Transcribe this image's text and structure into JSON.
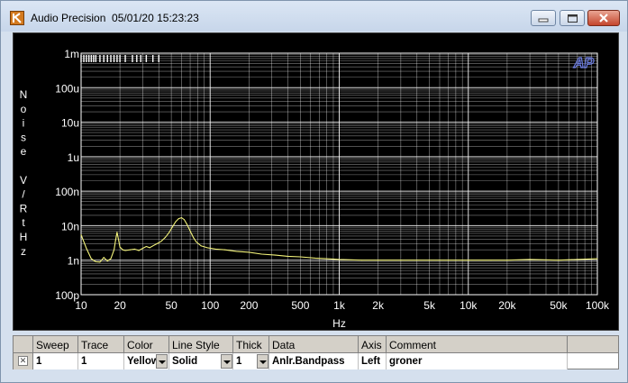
{
  "window": {
    "title": "Audio Precision  05/01/20 15:23:23",
    "app_name": "Audio Precision",
    "timestamp": "05/01/20 15:23:23"
  },
  "graph": {
    "y_axis_label_letters": [
      "N",
      "o",
      "i",
      "s",
      "e",
      " ",
      "V",
      "/",
      "R",
      "t",
      "H",
      "z"
    ],
    "x_axis_label": "Hz",
    "logo": "AP",
    "background_color": "#000000",
    "grid_color": "#ffffff",
    "trace_color": "#f2f27a"
  },
  "chart_data": {
    "type": "line",
    "xscale": "log",
    "yscale": "log",
    "xlim": [
      10,
      100000
    ],
    "ylim": [
      1e-10,
      0.001
    ],
    "xlabel": "Hz",
    "ylabel": "Noise V/RtHz",
    "grid": true,
    "x_ticks": [
      {
        "value": 10,
        "label": "10"
      },
      {
        "value": 20,
        "label": "20"
      },
      {
        "value": 50,
        "label": "50"
      },
      {
        "value": 100,
        "label": "100"
      },
      {
        "value": 200,
        "label": "200"
      },
      {
        "value": 500,
        "label": "500"
      },
      {
        "value": 1000,
        "label": "1k"
      },
      {
        "value": 2000,
        "label": "2k"
      },
      {
        "value": 5000,
        "label": "5k"
      },
      {
        "value": 10000,
        "label": "10k"
      },
      {
        "value": 20000,
        "label": "20k"
      },
      {
        "value": 50000,
        "label": "50k"
      },
      {
        "value": 100000,
        "label": "100k"
      }
    ],
    "y_ticks": [
      {
        "value": 0.001,
        "label": "1m"
      },
      {
        "value": 0.0001,
        "label": "100u"
      },
      {
        "value": 1e-05,
        "label": "10u"
      },
      {
        "value": 1e-06,
        "label": "1u"
      },
      {
        "value": 1e-07,
        "label": "100n"
      },
      {
        "value": 1e-08,
        "label": "10n"
      },
      {
        "value": 1e-09,
        "label": "1n"
      },
      {
        "value": 1e-10,
        "label": "100p"
      }
    ],
    "series": [
      {
        "x": [
          10,
          11,
          12,
          13,
          14,
          15,
          16,
          17,
          18,
          18.5,
          19,
          19.5,
          20,
          21,
          22,
          24,
          26,
          28,
          30,
          32,
          34,
          36,
          38,
          40,
          42,
          45,
          48,
          51,
          54,
          57,
          60,
          63,
          66,
          70,
          74,
          78,
          85,
          95,
          110,
          130,
          160,
          200,
          250,
          320,
          400,
          500,
          650,
          800,
          1000,
          1500,
          2000,
          3000,
          5000,
          7000,
          10000,
          15000,
          20000,
          30000,
          50000,
          70000,
          100000
        ],
        "y": [
          5.5e-09,
          2.2e-09,
          1.1e-09,
          9e-10,
          8.8e-10,
          1.2e-09,
          9.5e-10,
          1.1e-09,
          2e-09,
          3.8e-09,
          6.5e-09,
          4e-09,
          2.4e-09,
          2e-09,
          1.9e-09,
          2e-09,
          2.1e-09,
          1.9e-09,
          2.2e-09,
          2.5e-09,
          2.3e-09,
          2.6e-09,
          2.9e-09,
          3.2e-09,
          3.6e-09,
          4.6e-09,
          6.3e-09,
          9.2e-09,
          1.3e-08,
          1.6e-08,
          1.7e-08,
          1.5e-08,
          1.1e-08,
          7e-09,
          4.6e-09,
          3.4e-09,
          2.6e-09,
          2.3e-09,
          2.1e-09,
          2e-09,
          1.8e-09,
          1.7e-09,
          1.5e-09,
          1.4e-09,
          1.3e-09,
          1.25e-09,
          1.15e-09,
          1.1e-09,
          1.05e-09,
          1e-09,
          1e-09,
          1e-09,
          1e-09,
          1e-09,
          1e-09,
          1e-09,
          1e-09,
          1.05e-09,
          1e-09,
          1.05e-09,
          1.1e-09
        ]
      }
    ]
  },
  "table": {
    "columns": [
      "Sweep",
      "Trace",
      "Color",
      "Line Style",
      "Thick",
      "Data",
      "Axis",
      "Comment"
    ],
    "rows": [
      {
        "sweep": "1",
        "trace": "1",
        "color": "Yellow",
        "line_style": "Solid",
        "thick": "1",
        "data": "Anlr.Bandpass",
        "axis": "Left",
        "comment": "groner"
      }
    ]
  }
}
